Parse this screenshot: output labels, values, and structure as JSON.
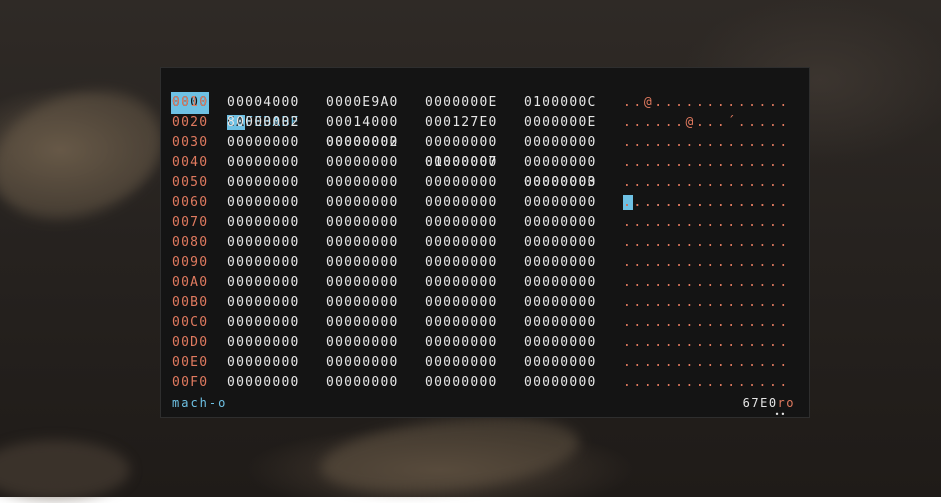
{
  "rows": [
    {
      "addr": "0000",
      "words": [
        "CAFEBABE",
        "00000002",
        "01000007",
        "00000003"
      ],
      "ascii": "................"
    },
    {
      "addr": "0010",
      "words": [
        "00004000",
        "0000E9A0",
        "0000000E",
        "0100000C"
      ],
      "ascii": "..@............."
    },
    {
      "addr": "0020",
      "words": [
        "80000002",
        "00014000",
        "000127E0",
        "0000000E"
      ],
      "ascii": "......@...´....."
    },
    {
      "addr": "0030",
      "words": [
        "00000000",
        "00000000",
        "00000000",
        "00000000"
      ],
      "ascii": "................"
    },
    {
      "addr": "0040",
      "words": [
        "00000000",
        "00000000",
        "00000000",
        "00000000"
      ],
      "ascii": "................"
    },
    {
      "addr": "0050",
      "words": [
        "00000000",
        "00000000",
        "00000000",
        "00000000"
      ],
      "ascii": "................"
    },
    {
      "addr": "0060",
      "words": [
        "00000000",
        "00000000",
        "00000000",
        "00000000"
      ],
      "ascii": "................"
    },
    {
      "addr": "0070",
      "words": [
        "00000000",
        "00000000",
        "00000000",
        "00000000"
      ],
      "ascii": "................"
    },
    {
      "addr": "0080",
      "words": [
        "00000000",
        "00000000",
        "00000000",
        "00000000"
      ],
      "ascii": "................"
    },
    {
      "addr": "0090",
      "words": [
        "00000000",
        "00000000",
        "00000000",
        "00000000"
      ],
      "ascii": "................"
    },
    {
      "addr": "00A0",
      "words": [
        "00000000",
        "00000000",
        "00000000",
        "00000000"
      ],
      "ascii": "................"
    },
    {
      "addr": "00B0",
      "words": [
        "00000000",
        "00000000",
        "00000000",
        "00000000"
      ],
      "ascii": "................"
    },
    {
      "addr": "00C0",
      "words": [
        "00000000",
        "00000000",
        "00000000",
        "00000000"
      ],
      "ascii": "................"
    },
    {
      "addr": "00D0",
      "words": [
        "00000000",
        "00000000",
        "00000000",
        "00000000"
      ],
      "ascii": "................"
    },
    {
      "addr": "00E0",
      "words": [
        "00000000",
        "00000000",
        "00000000",
        "00000000"
      ],
      "ascii": "................"
    },
    {
      "addr": "00F0",
      "words": [
        "00000000",
        "00000000",
        "00000000",
        "00000000"
      ],
      "ascii": "................"
    }
  ],
  "cursor": {
    "word_prefix": "CA",
    "word_rest": "FEBABE",
    "ascii_first": ".",
    "ascii_highlight": "...",
    "ascii_rest": "............"
  },
  "footer": {
    "format": "mach-o",
    "offset": "67E0",
    "mode": "ro",
    "dots": "••"
  },
  "colors": {
    "panel_bg": "#141414",
    "address": "#e07a5f",
    "hex_text": "#e6e6e6",
    "cursor": "#6ec1e4",
    "ascii": "#e07a5f"
  }
}
